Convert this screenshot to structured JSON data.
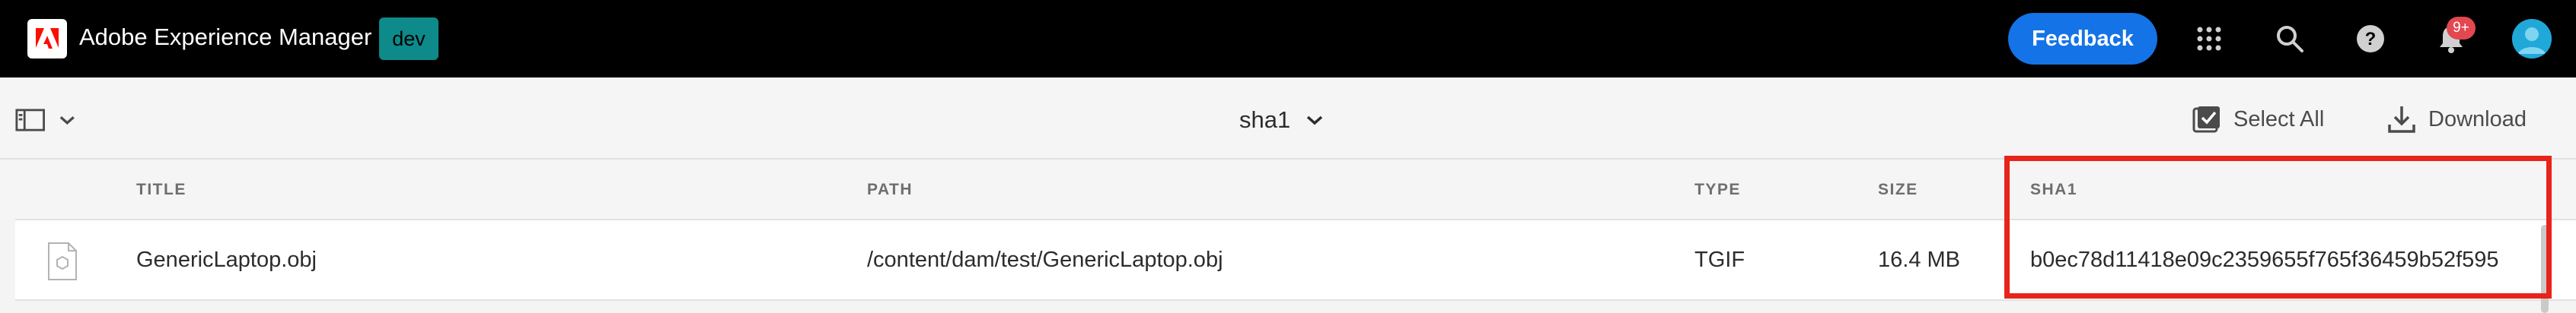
{
  "shell": {
    "app_title": "Adobe Experience Manager",
    "env_badge": "dev",
    "feedback_label": "Feedback",
    "notification_count": "9+",
    "colors": {
      "bar": "#000000",
      "feedback": "#1473e6",
      "env_badge": "#0e8a8a",
      "notification": "#e34850"
    }
  },
  "actionbar": {
    "title": "sha1",
    "select_all_label": "Select All",
    "download_label": "Download"
  },
  "table": {
    "columns": [
      "TITLE",
      "PATH",
      "TYPE",
      "SIZE",
      "SHA1"
    ],
    "rows": [
      {
        "title": "GenericLaptop.obj",
        "path": "/content/dam/test/GenericLaptop.obj",
        "type": "TGIF",
        "size": "16.4 MB",
        "sha1": "b0ec78d11418e09c2359655f765f36459b52f595"
      }
    ]
  },
  "annotation": {
    "color": "#e8231a"
  }
}
